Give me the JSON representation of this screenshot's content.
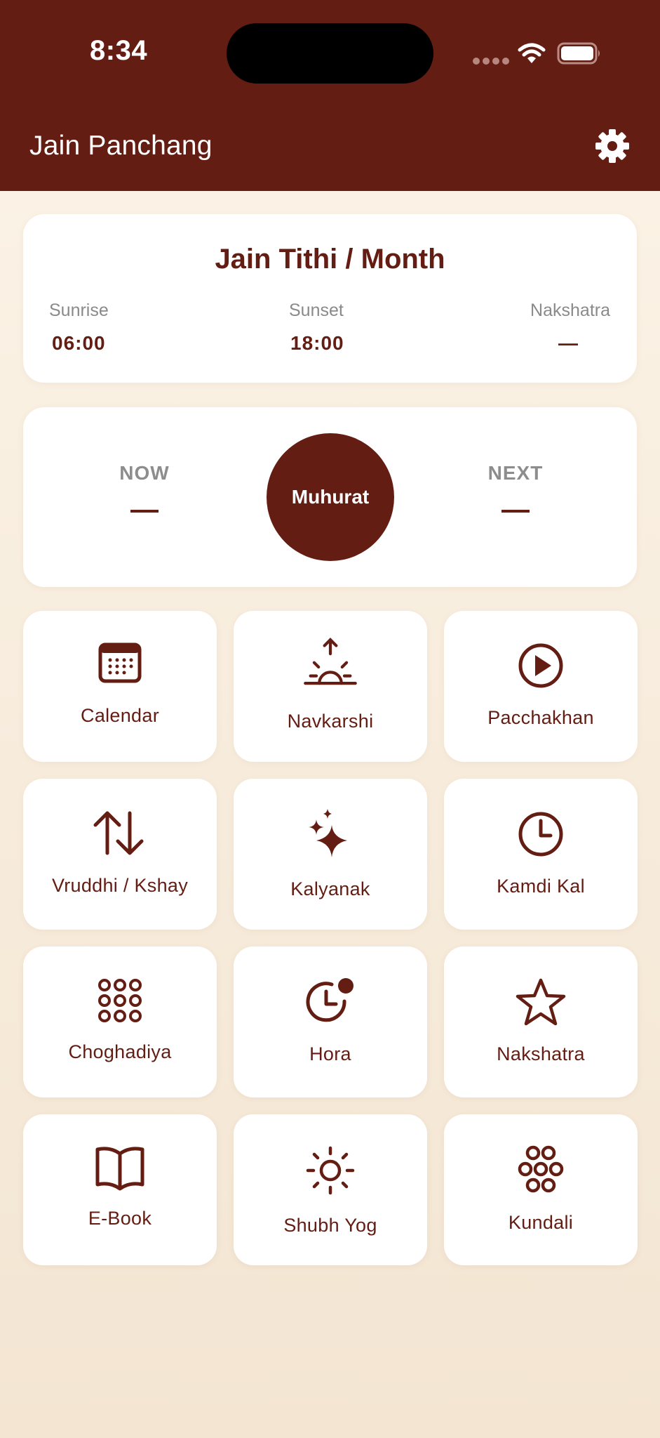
{
  "status_bar": {
    "time": "8:34"
  },
  "app": {
    "title": "Jain Panchang"
  },
  "info_card": {
    "title": "Jain Tithi / Month",
    "sunrise_label": "Sunrise",
    "sunrise_value": "06:00",
    "sunset_label": "Sunset",
    "sunset_value": "18:00",
    "nakshatra_label": "Nakshatra",
    "nakshatra_value": "—"
  },
  "muhurat_card": {
    "now_label": "NOW",
    "next_label": "NEXT",
    "center_label": "Muhurat"
  },
  "tiles": [
    {
      "label": "Calendar",
      "icon": "calendar-icon"
    },
    {
      "label": "Navkarshi",
      "icon": "sunrise-icon"
    },
    {
      "label": "Pacchakhan",
      "icon": "play-circle-icon"
    },
    {
      "label": "Vruddhi / Kshay",
      "icon": "up-down-arrows-icon"
    },
    {
      "label": "Kalyanak",
      "icon": "sparkles-icon"
    },
    {
      "label": "Kamdi Kal",
      "icon": "clock-icon"
    },
    {
      "label": "Choghadiya",
      "icon": "dot-grid-icon"
    },
    {
      "label": "Hora",
      "icon": "clock-badge-icon"
    },
    {
      "label": "Nakshatra",
      "icon": "star-icon"
    },
    {
      "label": "E-Book",
      "icon": "book-icon"
    },
    {
      "label": "Shubh Yog",
      "icon": "sun-icon"
    },
    {
      "label": "Kundali",
      "icon": "circle-cluster-icon"
    }
  ],
  "colors": {
    "primary": "#641d13",
    "background_top": "#fcf4e8",
    "background_bottom": "#f3e5d2",
    "card": "#ffffff",
    "muted_text": "#8a8a8a"
  }
}
